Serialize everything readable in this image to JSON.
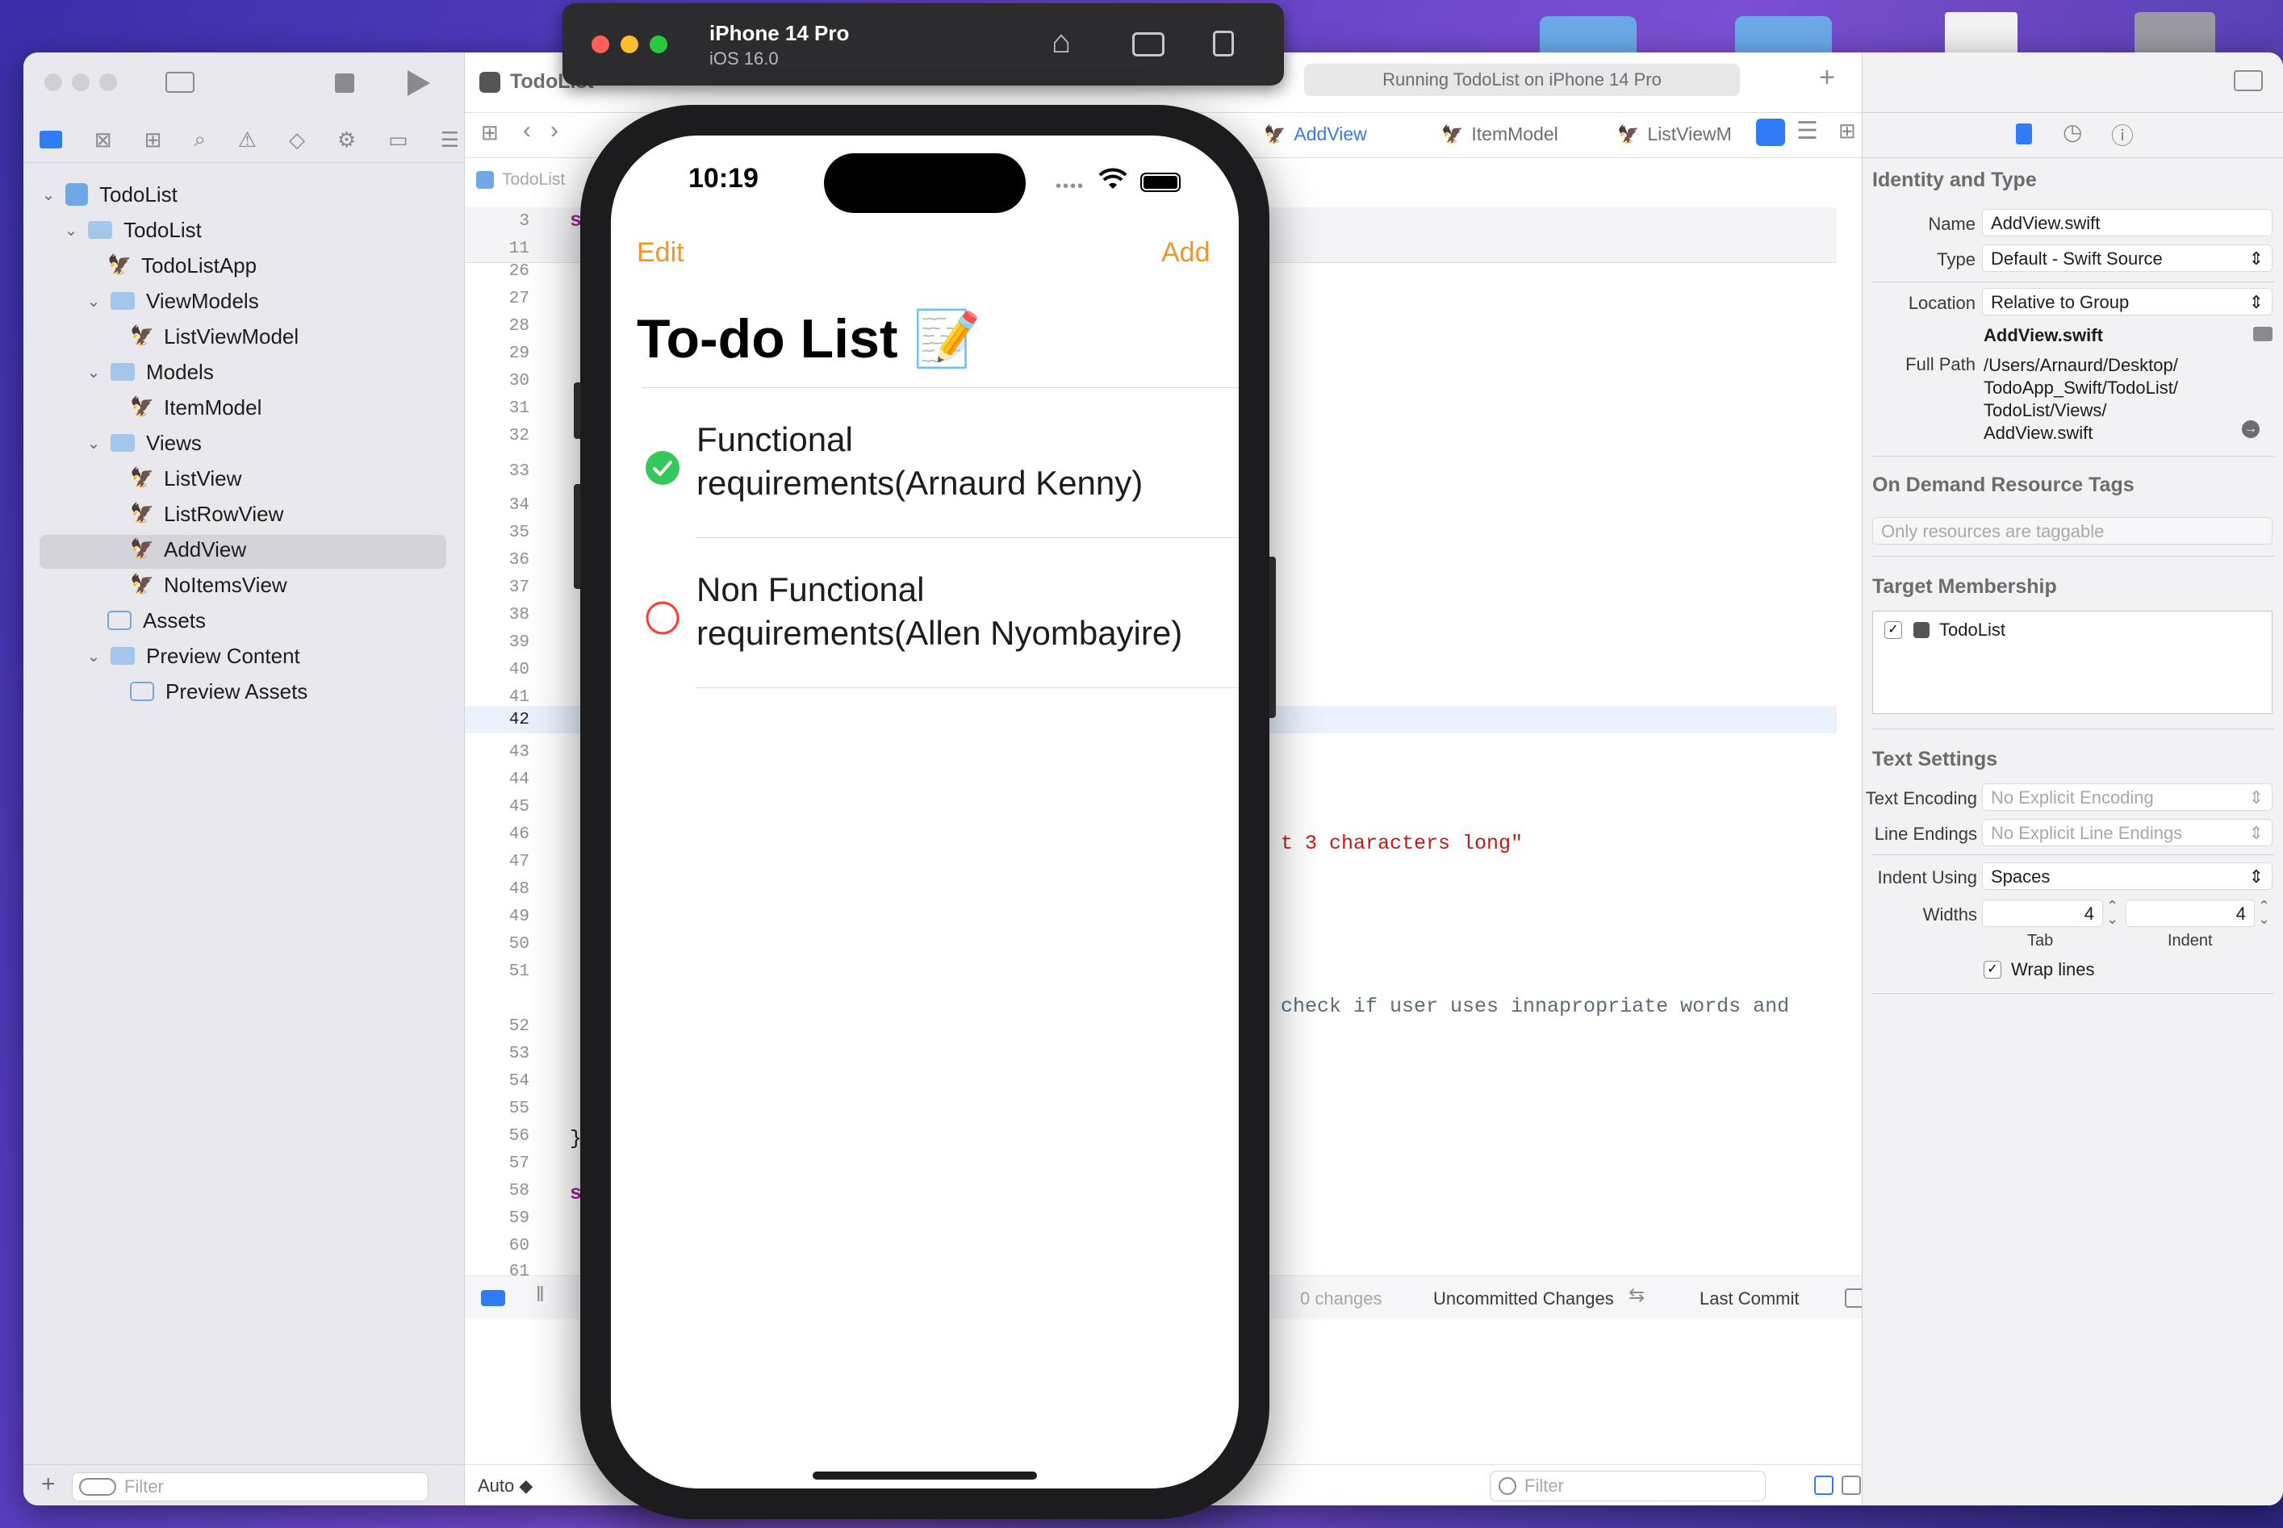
{
  "desktop": {
    "folders": [
      "",
      "",
      "",
      ""
    ]
  },
  "simulator": {
    "device_name": "iPhone 14 Pro",
    "os_version": "iOS 16.0"
  },
  "xcode": {
    "scheme_name": "TodoList",
    "run_status": "Running TodoList on iPhone 14 Pro",
    "tabs": [
      "AddView",
      "ItemModel",
      "ListViewM"
    ],
    "jump_bar_root": "TodoList",
    "navigator": {
      "items": [
        {
          "label": "TodoList",
          "type": "project",
          "level": 0,
          "expanded": true
        },
        {
          "label": "TodoList",
          "type": "folder",
          "level": 1,
          "expanded": true
        },
        {
          "label": "TodoListApp",
          "type": "swift",
          "level": 2
        },
        {
          "label": "ViewModels",
          "type": "folder",
          "level": 2,
          "expanded": true
        },
        {
          "label": "ListViewModel",
          "type": "swift",
          "level": 3
        },
        {
          "label": "Models",
          "type": "folder",
          "level": 2,
          "expanded": true
        },
        {
          "label": "ItemModel",
          "type": "swift",
          "level": 3
        },
        {
          "label": "Views",
          "type": "folder",
          "level": 2,
          "expanded": true
        },
        {
          "label": "ListView",
          "type": "swift",
          "level": 3
        },
        {
          "label": "ListRowView",
          "type": "swift",
          "level": 3
        },
        {
          "label": "AddView",
          "type": "swift",
          "level": 3,
          "selected": true
        },
        {
          "label": "NoItemsView",
          "type": "swift",
          "level": 3
        },
        {
          "label": "Assets",
          "type": "asset",
          "level": 2
        },
        {
          "label": "Preview Content",
          "type": "folder",
          "level": 2,
          "expanded": true
        },
        {
          "label": "Preview Assets",
          "type": "asset",
          "level": 3
        }
      ],
      "filter_placeholder": "Filter"
    },
    "editor": {
      "sticky_lines": [
        {
          "n": "3",
          "code": "str"
        },
        {
          "n": "11",
          "code": ""
        }
      ],
      "line_numbers": [
        "26",
        "27",
        "28",
        "29",
        "30",
        "31",
        "32",
        "33",
        "34",
        "35",
        "36",
        "37",
        "38",
        "39",
        "40",
        "41",
        "42",
        "43",
        "44",
        "45",
        "46",
        "47",
        "48",
        "49",
        "50",
        "51",
        "52",
        "53",
        "54",
        "55",
        "56",
        "57",
        "58",
        "59",
        "60",
        "61"
      ],
      "current_line": "42",
      "code_fragments": {
        "string_fragment": "t 3 characters long\"",
        "comment_fragment": "check if user uses innapropriate words and",
        "closing_brace": "}",
        "struct_keyword": "str"
      },
      "status": {
        "changes": "0 changes",
        "uncommitted": "Uncommitted Changes",
        "last_commit": "Last Commit"
      },
      "debug_scope": "Auto ◆",
      "filter_placeholder": "Filter"
    },
    "inspector": {
      "identity_header": "Identity and Type",
      "name_label": "Name",
      "name_value": "AddView.swift",
      "type_label": "Type",
      "type_value": "Default - Swift Source",
      "location_label": "Location",
      "location_value": "Relative to Group",
      "file_name": "AddView.swift",
      "full_path_label": "Full Path",
      "full_path_lines": [
        "/Users/Arnaurd/Desktop/",
        "TodoApp_Swift/TodoList/",
        "TodoList/Views/",
        "AddView.swift"
      ],
      "odr_header": "On Demand Resource Tags",
      "odr_placeholder": "Only resources are taggable",
      "target_header": "Target Membership",
      "target_name": "TodoList",
      "text_settings_header": "Text Settings",
      "encoding_label": "Text Encoding",
      "encoding_value": "No Explicit Encoding",
      "line_endings_label": "Line Endings",
      "line_endings_value": "No Explicit Line Endings",
      "indent_label": "Indent Using",
      "indent_value": "Spaces",
      "widths_label": "Widths",
      "tab_width": "4",
      "indent_width": "4",
      "tab_caption": "Tab",
      "indent_caption": "Indent",
      "wrap_label": "Wrap lines"
    }
  },
  "app": {
    "time": "10:19",
    "edit_label": "Edit",
    "add_label": "Add",
    "title": "To-do List 📝",
    "accent_color": "#f0952a",
    "items": [
      {
        "title_line1": "Functional",
        "title_line2": "requirements(Arnaurd Kenny)",
        "completed": true
      },
      {
        "title_line1": "Non Functional",
        "title_line2": "requirements(Allen Nyombayire)",
        "completed": false
      }
    ]
  },
  "colors": {
    "complete_green": "#34c759",
    "incomplete_red": "#ff3b30",
    "selection_blue": "#2f7cf6"
  }
}
